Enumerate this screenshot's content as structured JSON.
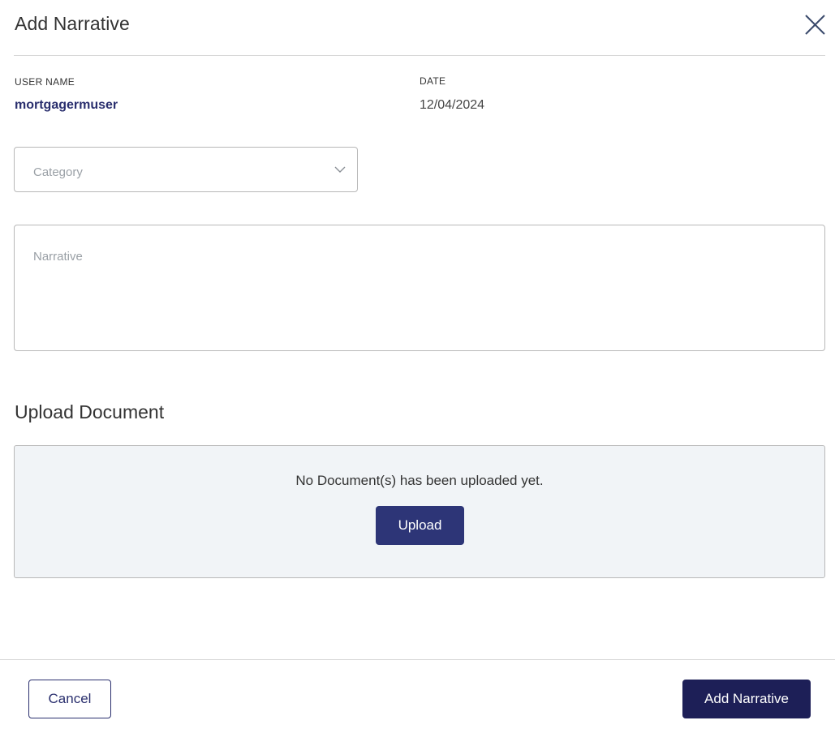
{
  "dialog": {
    "title": "Add Narrative"
  },
  "meta": {
    "username_label": "USER NAME",
    "username_value": "mortgagermuser",
    "date_label": "DATE",
    "date_value": "12/04/2024"
  },
  "form": {
    "category_placeholder": "Category",
    "narrative_placeholder": "Narrative"
  },
  "upload": {
    "section_title": "Upload Document",
    "empty_text": "No Document(s) has been uploaded yet.",
    "upload_label": "Upload"
  },
  "footer": {
    "cancel_label": "Cancel",
    "submit_label": "Add Narrative"
  },
  "icons": {
    "close": "close-icon",
    "chevron": "chevron-down-icon"
  },
  "colors": {
    "primary": "#1d1f57",
    "upload_button": "#2d3577",
    "link_text": "#2a2f6e",
    "panel_bg": "#f1f4f7"
  }
}
